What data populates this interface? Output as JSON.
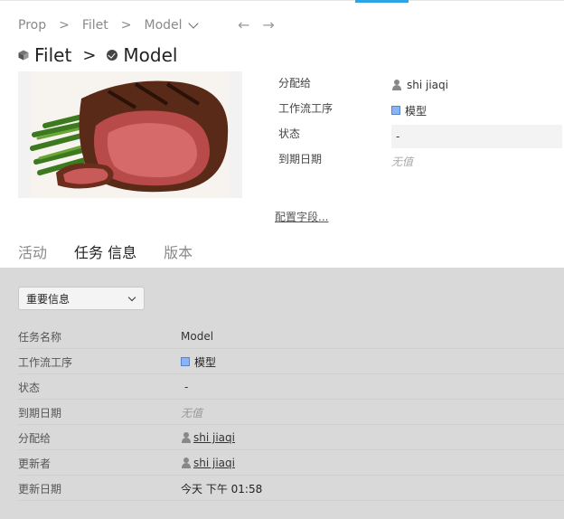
{
  "breadcrumb": {
    "items": [
      "Prop",
      "Filet",
      "Model"
    ],
    "separator": ">"
  },
  "nav": {
    "back": "←",
    "forward": "→"
  },
  "title": {
    "parent": "Filet",
    "separator": ">",
    "current": "Model"
  },
  "fields": [
    {
      "label": "分配给",
      "value": "shi jiaqi",
      "kind": "person"
    },
    {
      "label": "工作流工序",
      "value": "模型",
      "kind": "stage"
    },
    {
      "label": "状态",
      "value": "-",
      "kind": "boxed"
    },
    {
      "label": "到期日期",
      "value": "无值",
      "kind": "empty"
    }
  ],
  "config_link": "配置字段...",
  "tabs": [
    {
      "label": "活动",
      "active": false
    },
    {
      "label": "任务 信息",
      "active": true
    },
    {
      "label": "版本",
      "active": false
    }
  ],
  "panel": {
    "select_value": "重要信息",
    "rows": [
      {
        "key": "任务名称",
        "value": "Model"
      },
      {
        "key": "工作流工序",
        "value": "模型"
      },
      {
        "key": "状态",
        "value": "-"
      },
      {
        "key": "到期日期",
        "value": "无值"
      },
      {
        "key": "分配给",
        "value": "shi jiaqi"
      },
      {
        "key": "更新者",
        "value": "shi jiaqi"
      },
      {
        "key": "更新日期",
        "value": "今天 下午 01:58"
      }
    ]
  },
  "colors": {
    "accent": "#2ea3e6",
    "panel_bg": "#d9d9d9",
    "stage": "#8ab4f8"
  }
}
